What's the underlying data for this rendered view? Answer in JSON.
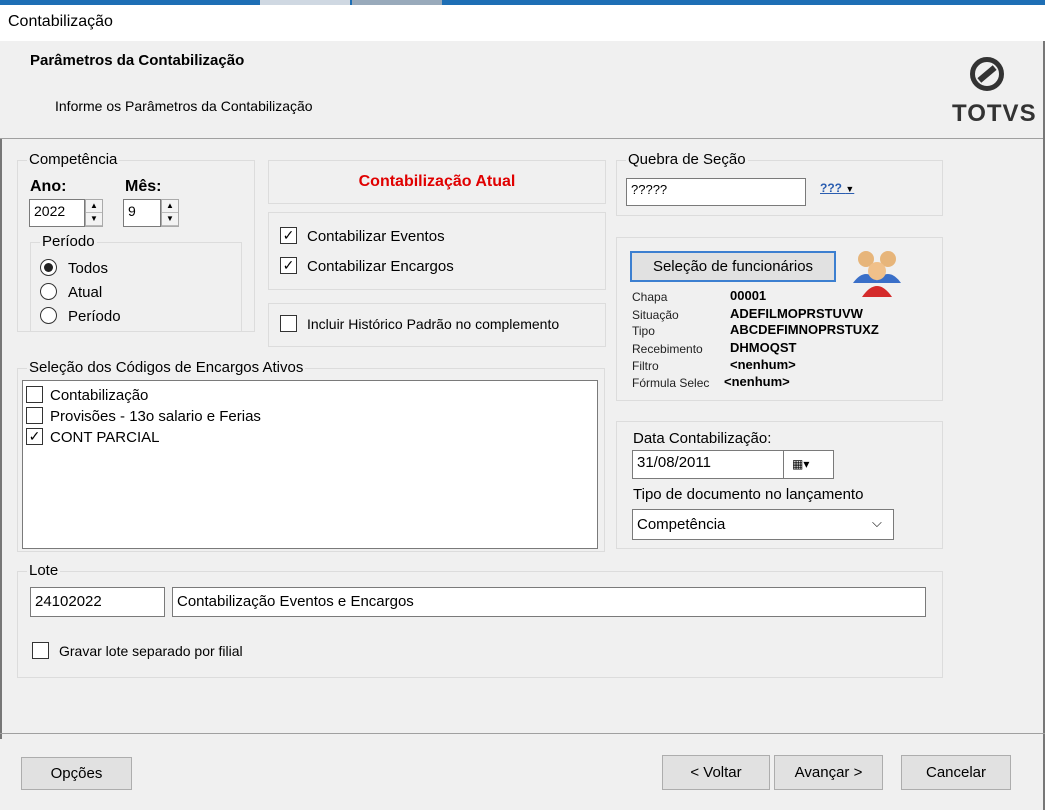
{
  "window": {
    "title": "Contabilização"
  },
  "header": {
    "title": "Parâmetros da Contabilização",
    "subtitle": "Informe os Parâmetros da Contabilização",
    "logo_text": "TOTVS"
  },
  "competencia": {
    "group_label": "Competência",
    "ano_label": "Ano:",
    "ano_value": "2022",
    "mes_label": "Mês:",
    "mes_value": "9",
    "periodo": {
      "group_label": "Período",
      "options": [
        {
          "label": "Todos",
          "selected": true
        },
        {
          "label": "Atual",
          "selected": false
        },
        {
          "label": "Período",
          "selected": false
        }
      ]
    }
  },
  "contabilizacao_atual": {
    "label": "Contabilização Atual",
    "color": "#e00000"
  },
  "options": {
    "eventos": {
      "label": "Contabilizar Eventos",
      "checked": true
    },
    "encargos": {
      "label": "Contabilizar Encargos",
      "checked": true
    },
    "historico": {
      "label": "Incluir Histórico Padrão no complemento",
      "checked": false
    }
  },
  "quebra": {
    "group_label": "Quebra de Seção",
    "value": "?????",
    "icon_text": "???"
  },
  "funcionarios": {
    "button_label": "Seleção de funcionários",
    "fields": [
      {
        "label": "Chapa",
        "value": "00001"
      },
      {
        "label": "Situação",
        "value": "ADEFILMOPRSTUVW"
      },
      {
        "label": "Tipo",
        "value": "ABCDEFIMNOPRSTUXZ"
      },
      {
        "label": "Recebimento",
        "value": "DHMOQST"
      },
      {
        "label": "Filtro",
        "value": "<nenhum>"
      },
      {
        "label": "Fórmula Selec",
        "value": "<nenhum>"
      }
    ]
  },
  "encargos": {
    "group_label": "Seleção dos Códigos de Encargos Ativos",
    "items": [
      {
        "label": "Contabilização",
        "checked": false
      },
      {
        "label": "Provisões - 13o salario e Ferias",
        "checked": false
      },
      {
        "label": "CONT PARCIAL",
        "checked": true
      }
    ]
  },
  "data": {
    "label": "Data Contabilização:",
    "value": "31/08/2011",
    "tipo_label": "Tipo de documento no lançamento",
    "tipo_value": "Competência"
  },
  "lote": {
    "group_label": "Lote",
    "code": "24102022",
    "description": "Contabilização Eventos e Encargos",
    "separado_label": "Gravar lote separado por filial",
    "separado_checked": false
  },
  "footer": {
    "opcoes": "Opções",
    "voltar": "< Voltar",
    "avancar": "Avançar >",
    "cancelar": "Cancelar"
  }
}
